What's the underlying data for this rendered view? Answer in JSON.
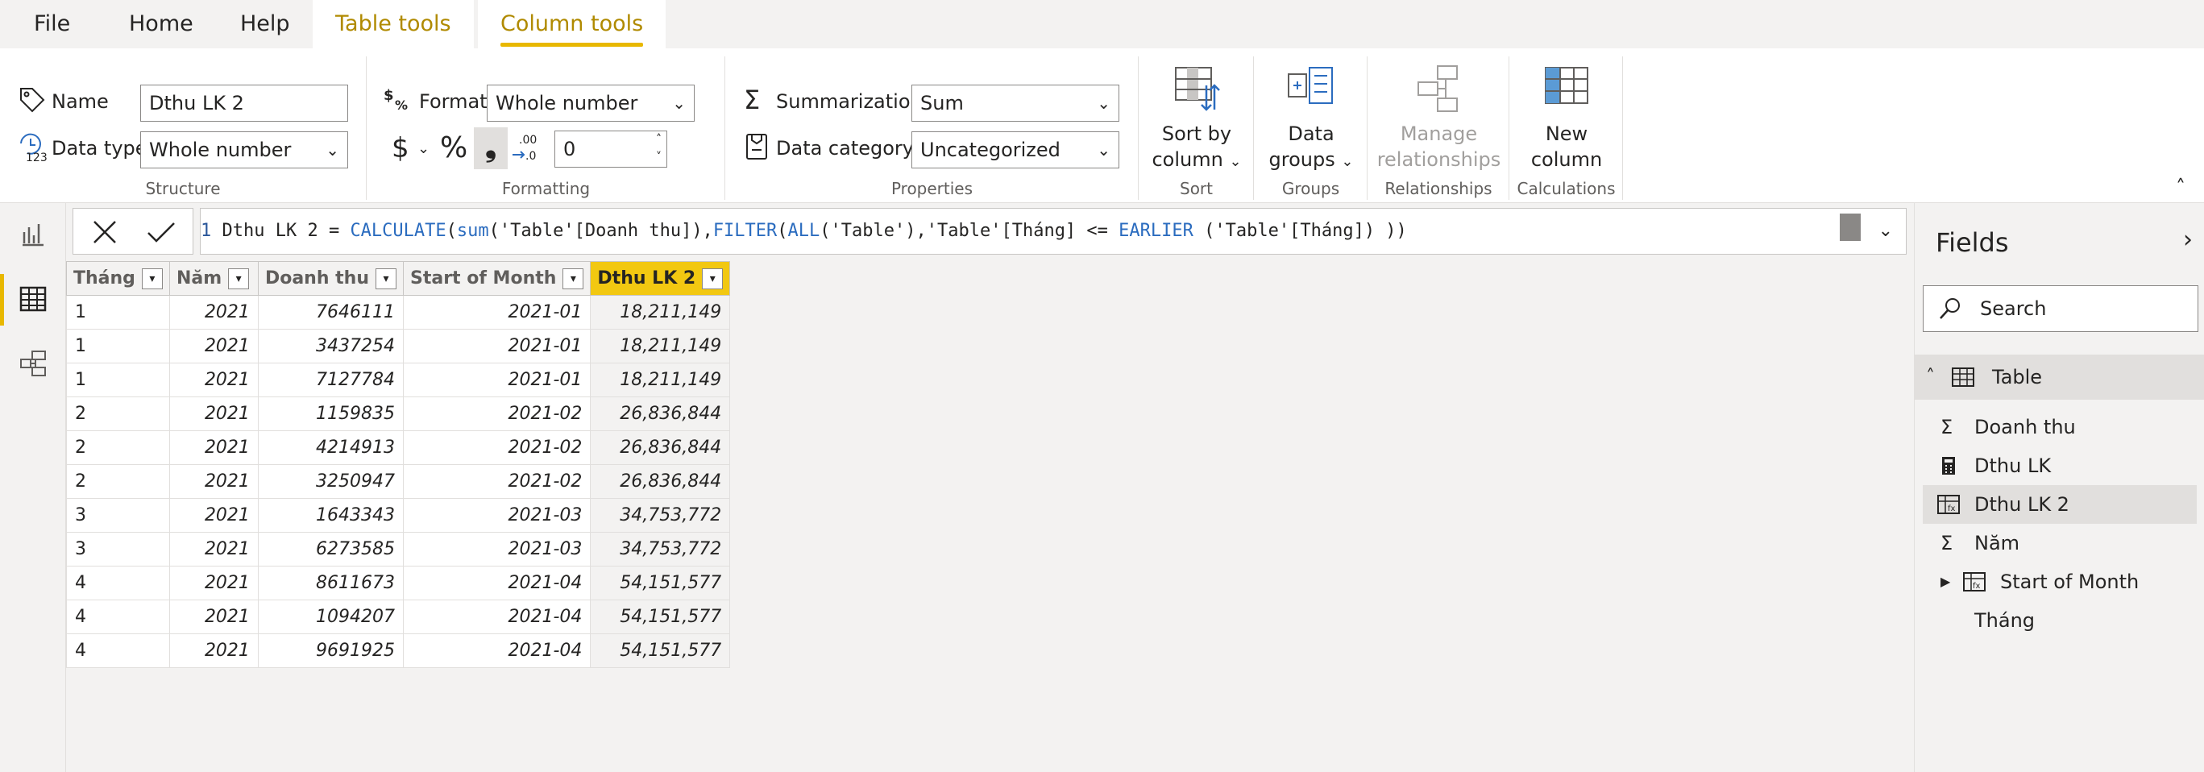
{
  "tabs": [
    {
      "label": "File"
    },
    {
      "label": "Home"
    },
    {
      "label": "Help"
    },
    {
      "label": "Table tools"
    },
    {
      "label": "Column tools"
    }
  ],
  "ribbon": {
    "structure": {
      "name_label": "Name",
      "name_value": "Dthu LK 2",
      "datatype_label": "Data type",
      "datatype_value": "Whole number",
      "group_label": "Structure"
    },
    "formatting": {
      "format_label": "Format",
      "format_value": "Whole number",
      "decimals_value": "0",
      "group_label": "Formatting"
    },
    "properties": {
      "summarization_label": "Summarization",
      "summarization_value": "Sum",
      "category_label": "Data category",
      "category_value": "Uncategorized",
      "group_label": "Properties"
    },
    "sort": {
      "line1": "Sort by",
      "line2": "column",
      "group_label": "Sort"
    },
    "groups": {
      "line1": "Data",
      "line2": "groups",
      "group_label": "Groups"
    },
    "relationships": {
      "line1": "Manage",
      "line2": "relationships",
      "group_label": "Relationships"
    },
    "calculations": {
      "line1": "New",
      "line2": "column",
      "group_label": "Calculations"
    }
  },
  "formula": {
    "line_number": "1",
    "parts": [
      {
        "text": " Dthu LK 2 = ",
        "kw": false
      },
      {
        "text": "CALCULATE",
        "kw": true
      },
      {
        "text": "(",
        "kw": false
      },
      {
        "text": "sum",
        "kw": true
      },
      {
        "text": "('Table'[Doanh thu]),",
        "kw": false
      },
      {
        "text": "FILTER",
        "kw": true
      },
      {
        "text": "(",
        "kw": false
      },
      {
        "text": "ALL",
        "kw": true
      },
      {
        "text": "('Table'),'Table'[Tháng] <= ",
        "kw": false
      },
      {
        "text": "EARLIER",
        "kw": true
      },
      {
        "text": " ('Table'[Tháng]) ))",
        "kw": false
      }
    ]
  },
  "table": {
    "columns": [
      "Tháng",
      "Năm",
      "Doanh thu",
      "Start of Month",
      "Dthu LK 2"
    ],
    "rows": [
      [
        "1",
        "2021",
        "7646111",
        "2021-01",
        "18,211,149"
      ],
      [
        "1",
        "2021",
        "3437254",
        "2021-01",
        "18,211,149"
      ],
      [
        "1",
        "2021",
        "7127784",
        "2021-01",
        "18,211,149"
      ],
      [
        "2",
        "2021",
        "1159835",
        "2021-02",
        "26,836,844"
      ],
      [
        "2",
        "2021",
        "4214913",
        "2021-02",
        "26,836,844"
      ],
      [
        "2",
        "2021",
        "3250947",
        "2021-02",
        "26,836,844"
      ],
      [
        "3",
        "2021",
        "1643343",
        "2021-03",
        "34,753,772"
      ],
      [
        "3",
        "2021",
        "6273585",
        "2021-03",
        "34,753,772"
      ],
      [
        "4",
        "2021",
        "8611673",
        "2021-04",
        "54,151,577"
      ],
      [
        "4",
        "2021",
        "1094207",
        "2021-04",
        "54,151,577"
      ],
      [
        "4",
        "2021",
        "9691925",
        "2021-04",
        "54,151,577"
      ]
    ]
  },
  "fields": {
    "title": "Fields",
    "search_placeholder": "Search",
    "table_name": "Table",
    "items": [
      {
        "label": "Doanh thu",
        "icon": "sigma-icon"
      },
      {
        "label": "Dthu LK",
        "icon": "calculator-icon"
      },
      {
        "label": "Dthu LK 2",
        "icon": "calculated-column-icon"
      },
      {
        "label": "Năm",
        "icon": "sigma-icon"
      },
      {
        "label": "Start of Month",
        "icon": "date-hierarchy-icon"
      },
      {
        "label": "Tháng",
        "icon": ""
      }
    ]
  },
  "colors": {
    "accent": "#f2c811",
    "context_tab": "#b08a00",
    "keyword": "#2b6cbf"
  }
}
